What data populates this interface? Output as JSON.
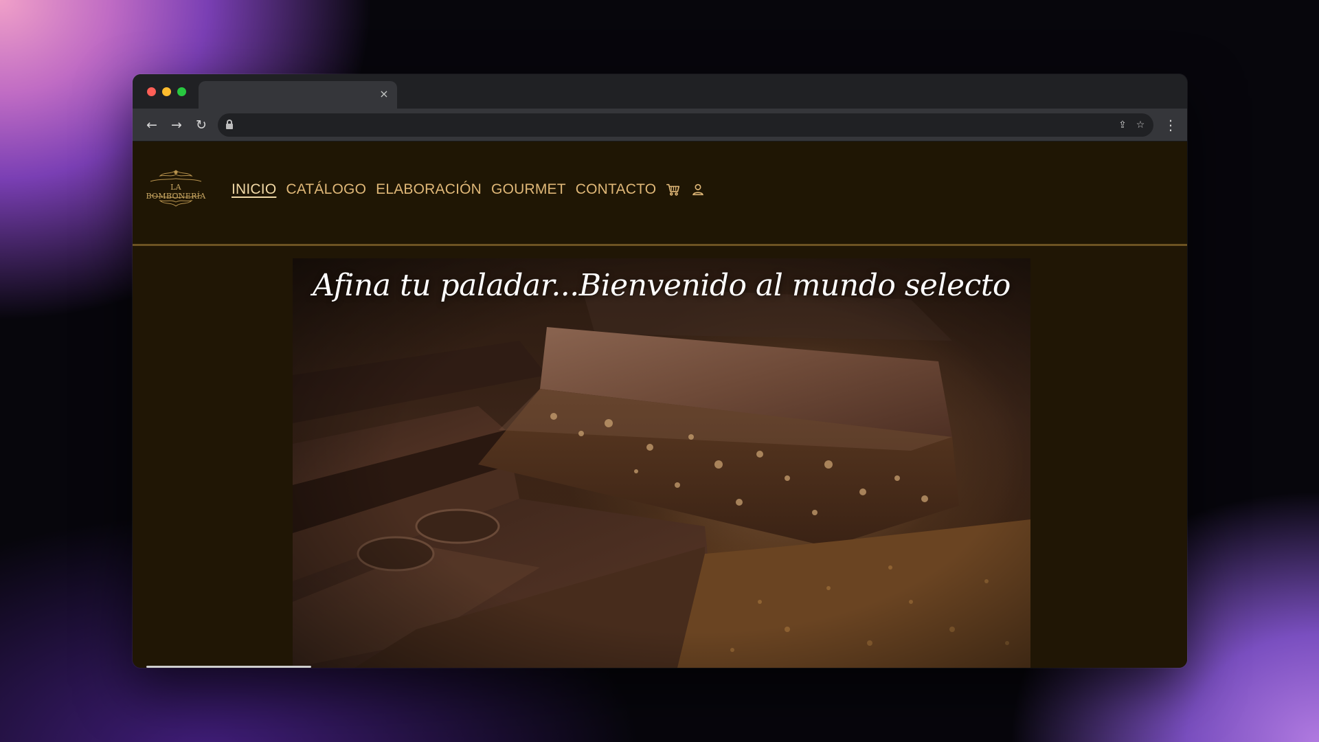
{
  "browser": {
    "tab_close_glyph": "×",
    "nav": {
      "back_glyph": "←",
      "forward_glyph": "→",
      "reload_glyph": "↻"
    },
    "url_actions": {
      "share_glyph": "⇪",
      "bookmark_glyph": "☆"
    },
    "menu_glyph": "⋮"
  },
  "site": {
    "logo_text": "LA BOMBONERÍA",
    "nav": {
      "inicio": "INICIO",
      "catalogo": "CATÁLOGO",
      "elaboracion": "ELABORACIÓN",
      "gourmet": "GOURMET",
      "contacto": "CONTACTO"
    },
    "active_nav": "INICIO",
    "icons": [
      "cart-icon",
      "user-icon"
    ],
    "colors": {
      "header_bg": "#1f1604",
      "nav_text": "#e0b878",
      "divider": "#6d5322"
    },
    "hero": {
      "title": "Afina tu paladar...Bienvenido al mundo selecto"
    }
  }
}
